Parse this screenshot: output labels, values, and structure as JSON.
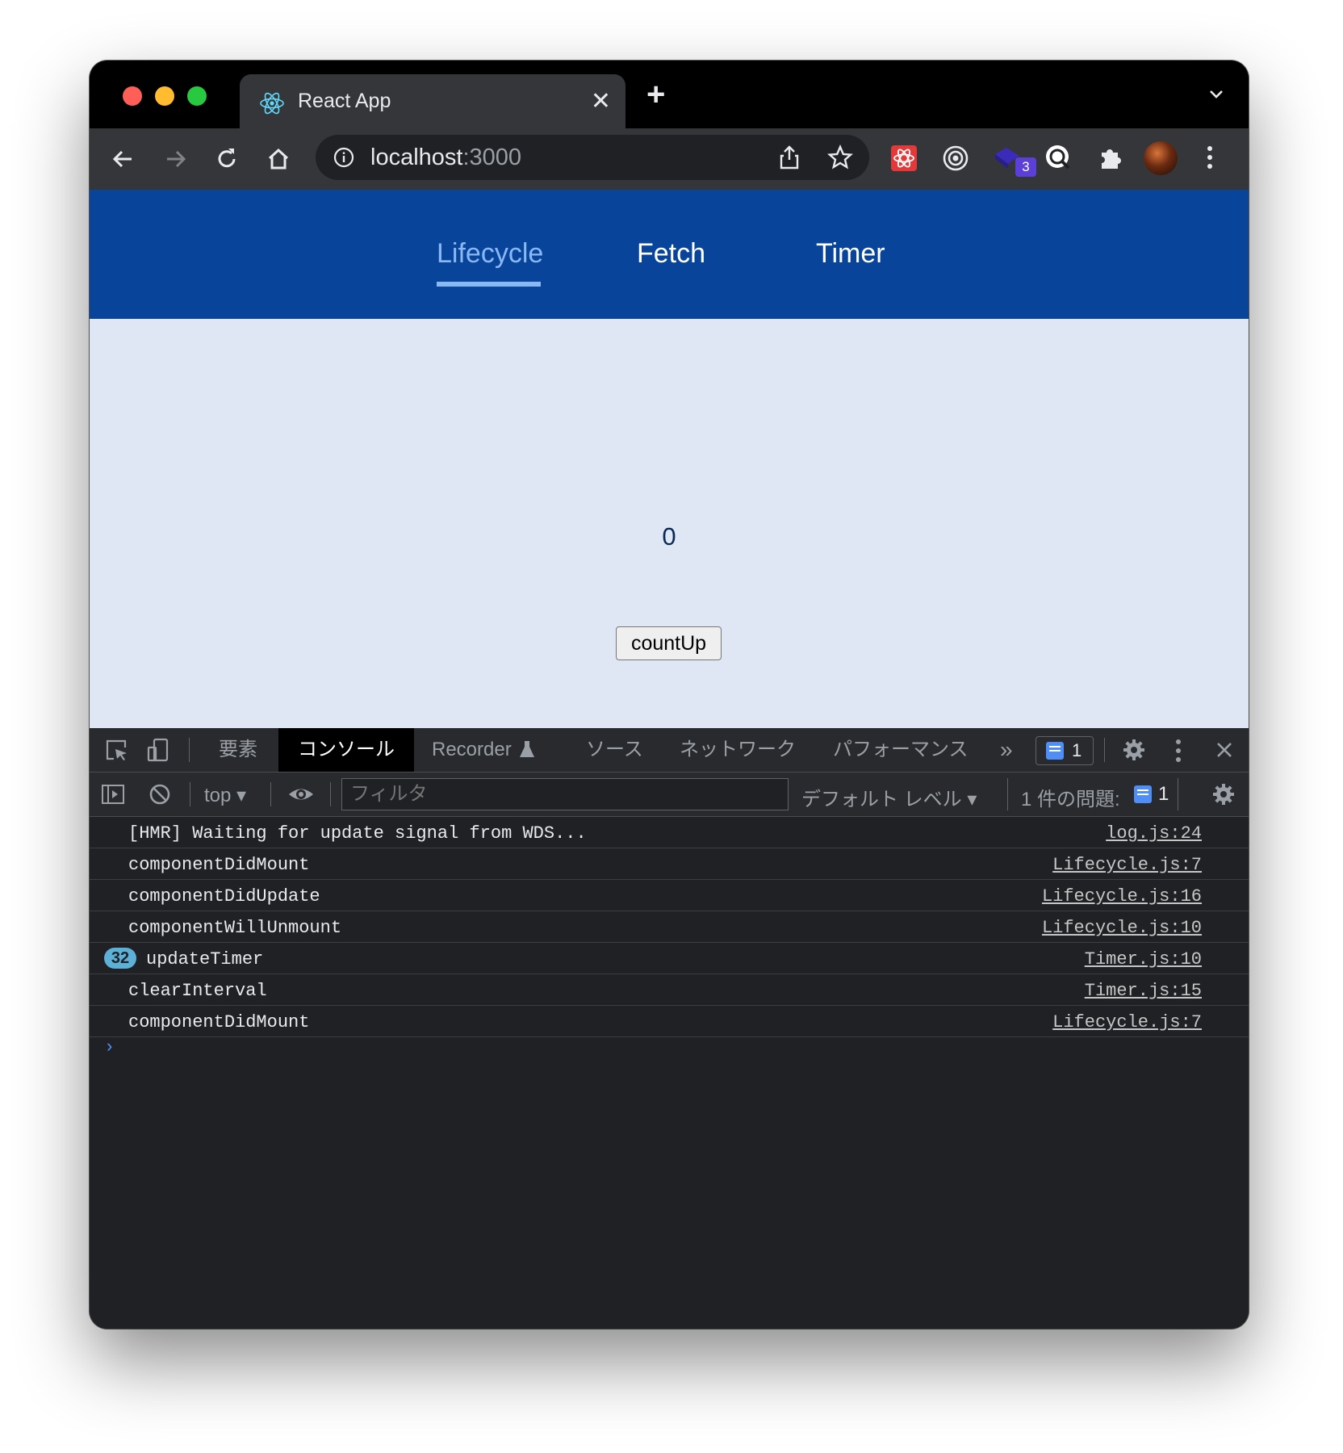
{
  "browser": {
    "tab_title": "React App",
    "tab_close": "✕",
    "new_tab": "+",
    "url_host": "localhost",
    "url_port": ":3000",
    "extension_badge": "3"
  },
  "app": {
    "nav": [
      "Lifecycle",
      "Fetch",
      "Timer"
    ],
    "active_nav": "Lifecycle",
    "count": "0",
    "button_label": "countUp"
  },
  "devtools": {
    "tabs": [
      "要素",
      "コンソール",
      "Recorder",
      "ソース",
      "ネットワーク",
      "パフォーマンス"
    ],
    "active_tab": "コンソール",
    "more_tabs": "»",
    "issues_count": "1",
    "context": "top",
    "filter_placeholder": "フィルタ",
    "levels": "デフォルト レベル",
    "issues_label": "1 件の問題:",
    "issues_num": "1",
    "messages": [
      {
        "text": "[HMR] Waiting for update signal from WDS...",
        "source": "log.js:24",
        "repeat": ""
      },
      {
        "text": "componentDidMount",
        "source": "Lifecycle.js:7",
        "repeat": ""
      },
      {
        "text": "componentDidUpdate",
        "source": "Lifecycle.js:16",
        "repeat": ""
      },
      {
        "text": "componentWillUnmount",
        "source": "Lifecycle.js:10",
        "repeat": ""
      },
      {
        "text": "updateTimer",
        "source": "Timer.js:10",
        "repeat": "32"
      },
      {
        "text": "clearInterval",
        "source": "Timer.js:15",
        "repeat": ""
      },
      {
        "text": "componentDidMount",
        "source": "Lifecycle.js:7",
        "repeat": ""
      }
    ],
    "prompt": "›"
  },
  "colors": {
    "app_nav_bg": "#07449a",
    "page_bg": "#dfe7f4",
    "active_nav": "#8ab8f3",
    "devtools_bg": "#202124"
  }
}
